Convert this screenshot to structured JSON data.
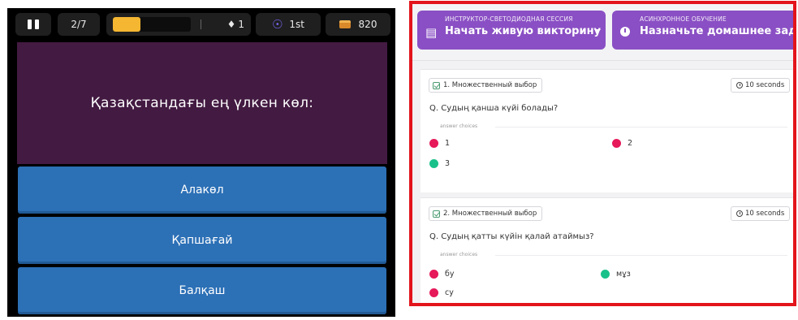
{
  "game": {
    "progress_label": "2/7",
    "progress_fraction": 0.35,
    "streak_value": "1",
    "rank_label": "1st",
    "coins": "820",
    "question": "Қазақстандағы ең үлкен көл:",
    "answers": [
      "Алакөл",
      "Қапшағай",
      "Балқаш"
    ],
    "colors": {
      "question_bg": "#431a42",
      "answer_bg": "#2c70b6",
      "progress_fill": "#f5b731"
    }
  },
  "preview": {
    "live_session": {
      "caption": "ИНСТРУКТОР-СВЕТОДИОДНАЯ СЕССИЯ",
      "label": "Начать живую викторину"
    },
    "homework": {
      "caption": "АСИНХРОННОЕ ОБУЧЕНИЕ",
      "label": "Назначьте домашнее задание"
    },
    "accent_color": "#8a4fc4",
    "questions": [
      {
        "type_label": "1. Множественный выбор",
        "time_label": "10 seconds",
        "text": "Q. Судың қанша күйі болады?",
        "choices_label": "answer choices",
        "choices": [
          {
            "text": "1",
            "correct": false
          },
          {
            "text": "2",
            "correct": false
          },
          {
            "text": "3",
            "correct": true
          }
        ]
      },
      {
        "type_label": "2. Множественный выбор",
        "time_label": "10 seconds",
        "text": "Q. Судың қатты күйін қалай атаймыз?",
        "choices_label": "answer choices",
        "choices": [
          {
            "text": "бу",
            "correct": false
          },
          {
            "text": "мұз",
            "correct": true
          },
          {
            "text": "су",
            "correct": false
          }
        ]
      }
    ]
  }
}
